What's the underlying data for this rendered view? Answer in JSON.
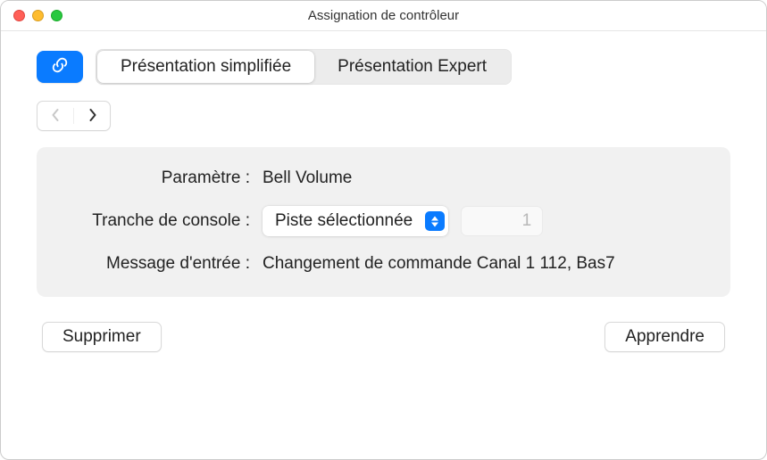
{
  "window": {
    "title": "Assignation de contrôleur"
  },
  "tabs": {
    "simplified": "Présentation simplifiée",
    "expert": "Présentation Expert",
    "active": "simplified"
  },
  "panel": {
    "parameter_label": "Paramètre :",
    "parameter_value": "Bell Volume",
    "channel_strip_label": "Tranche de console :",
    "channel_strip_select": "Piste sélectionnée",
    "channel_strip_number": "1",
    "input_message_label": "Message d'entrée :",
    "input_message_value": "Changement de commande Canal 1  112, Bas7"
  },
  "buttons": {
    "delete": "Supprimer",
    "learn": "Apprendre"
  }
}
